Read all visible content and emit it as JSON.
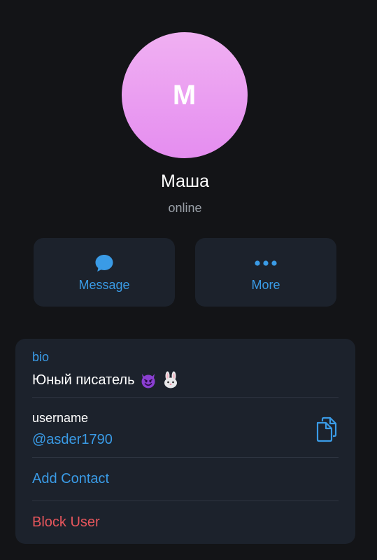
{
  "profile": {
    "initial": "M",
    "name": "Маша",
    "status": "online",
    "avatar_gradient": [
      "#f0b0f2",
      "#e58df0"
    ]
  },
  "actions": {
    "message_label": "Message",
    "more_label": "More"
  },
  "info": {
    "bio_label": "bio",
    "bio_text": "Юный писатель",
    "bio_emojis": [
      "smiling-devil-emoji",
      "rabbit-emoji"
    ],
    "username_label": "username",
    "username_value": "@asder1790",
    "add_contact_label": "Add Contact",
    "block_user_label": "Block User"
  },
  "colors": {
    "background": "#131417",
    "card": "#1c222c",
    "accent": "#3a9be6",
    "danger": "#e7565c",
    "secondary_text": "#9aa0a8"
  }
}
